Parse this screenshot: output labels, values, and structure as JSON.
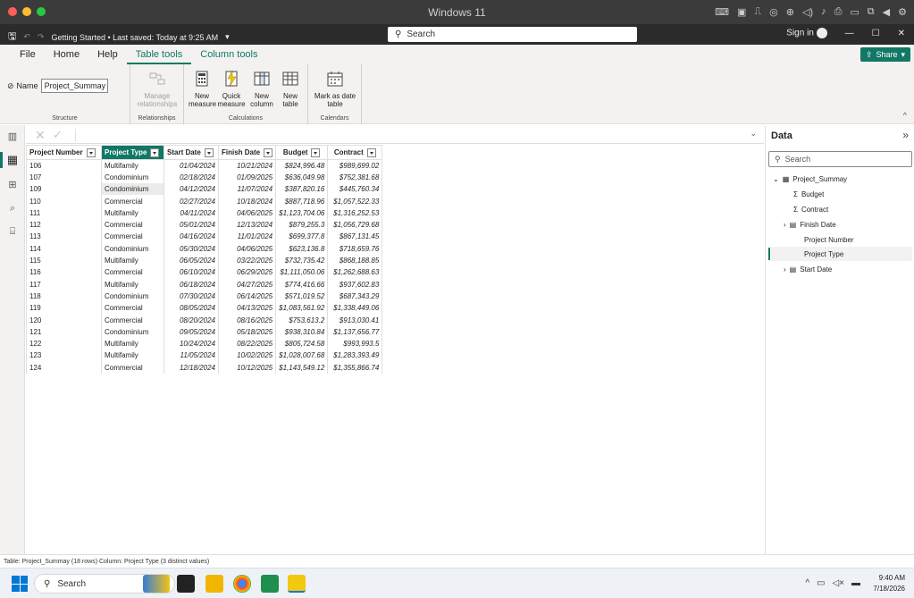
{
  "mac_window": {
    "title": "Windows 11"
  },
  "titlebar": {
    "file_status": "Getting Started • Last saved: Today at 9:25 AM",
    "search_placeholder": "Search",
    "sign_in": "Sign in"
  },
  "ribbon": {
    "tabs": [
      "File",
      "Home",
      "Help",
      "Table tools",
      "Column tools"
    ],
    "active_tab": "Table tools",
    "share_label": "Share",
    "structure": {
      "name_label": "Name",
      "name_value": "Project_Summay",
      "group_label": "Structure"
    },
    "relationships": {
      "button": "Manage relationships",
      "group_label": "Relationships"
    },
    "calculations": {
      "buttons": [
        "New measure",
        "Quick measure",
        "New column",
        "New table"
      ],
      "group_label": "Calculations"
    },
    "calendars": {
      "button": "Mark as date table",
      "group_label": "Calendars"
    }
  },
  "table": {
    "columns": [
      "Project Number",
      "Project Type",
      "Start Date",
      "Finish Date",
      "Budget",
      "Contract"
    ],
    "selected_column": "Project Type",
    "rows": [
      [
        "106",
        "Multifamily",
        "01/04/2024",
        "10/21/2024",
        "$824,996.48",
        "$989,699.02"
      ],
      [
        "107",
        "Condominium",
        "02/18/2024",
        "01/09/2025",
        "$636,049.98",
        "$752,381.68"
      ],
      [
        "109",
        "Condominium",
        "04/12/2024",
        "11/07/2024",
        "$387,820.16",
        "$445,760.34"
      ],
      [
        "110",
        "Commercial",
        "02/27/2024",
        "10/18/2024",
        "$887,718.96",
        "$1,057,522.33"
      ],
      [
        "111",
        "Multifamily",
        "04/11/2024",
        "04/06/2025",
        "$1,123,704.06",
        "$1,316,252.53"
      ],
      [
        "112",
        "Commercial",
        "05/01/2024",
        "12/13/2024",
        "$879,255.3",
        "$1,056,729.68"
      ],
      [
        "113",
        "Commercial",
        "04/16/2024",
        "11/01/2024",
        "$699,377.8",
        "$867,131.45"
      ],
      [
        "114",
        "Condominium",
        "05/30/2024",
        "04/06/2025",
        "$623,136.8",
        "$718,659.76"
      ],
      [
        "115",
        "Multifamily",
        "06/05/2024",
        "03/22/2025",
        "$732,735.42",
        "$868,188.85"
      ],
      [
        "116",
        "Commercial",
        "06/10/2024",
        "06/29/2025",
        "$1,111,050.06",
        "$1,262,688.63"
      ],
      [
        "117",
        "Multifamily",
        "06/18/2024",
        "04/27/2025",
        "$774,416.66",
        "$937,602.83"
      ],
      [
        "118",
        "Condominium",
        "07/30/2024",
        "06/14/2025",
        "$571,019.52",
        "$687,343.29"
      ],
      [
        "119",
        "Commercial",
        "08/05/2024",
        "04/13/2025",
        "$1,083,561.92",
        "$1,338,449.06"
      ],
      [
        "120",
        "Commercial",
        "08/20/2024",
        "08/16/2025",
        "$753,613.2",
        "$913,030.41"
      ],
      [
        "121",
        "Condominium",
        "09/05/2024",
        "05/18/2025",
        "$938,310.84",
        "$1,137,656.77"
      ],
      [
        "122",
        "Multifamily",
        "10/24/2024",
        "08/22/2025",
        "$805,724.58",
        "$993,993.5"
      ],
      [
        "123",
        "Multifamily",
        "11/05/2024",
        "10/02/2025",
        "$1,028,007.68",
        "$1,283,393.49"
      ],
      [
        "124",
        "Commercial",
        "12/18/2024",
        "10/12/2025",
        "$1,143,549.12",
        "$1,355,866.74"
      ]
    ]
  },
  "data_pane": {
    "title": "Data",
    "search_placeholder": "Search",
    "table_name": "Project_Summay",
    "fields": [
      {
        "label": "Budget",
        "icon": "sigma"
      },
      {
        "label": "Contract",
        "icon": "sigma"
      },
      {
        "label": "Finish Date",
        "icon": "calendar"
      },
      {
        "label": "Project Number",
        "icon": "none"
      },
      {
        "label": "Project Type",
        "icon": "none"
      },
      {
        "label": "Start Date",
        "icon": "calendar"
      }
    ]
  },
  "status": "Table: Project_Summay (18 rows) Column: Project Type (3 distinct values)",
  "taskbar": {
    "search": "Search",
    "time": "9:40 AM",
    "date": "7/18/2026"
  },
  "colors": {
    "accent": "#117865",
    "mac_close": "#ff5f57",
    "mac_min": "#febc2e",
    "mac_max": "#28c840"
  }
}
